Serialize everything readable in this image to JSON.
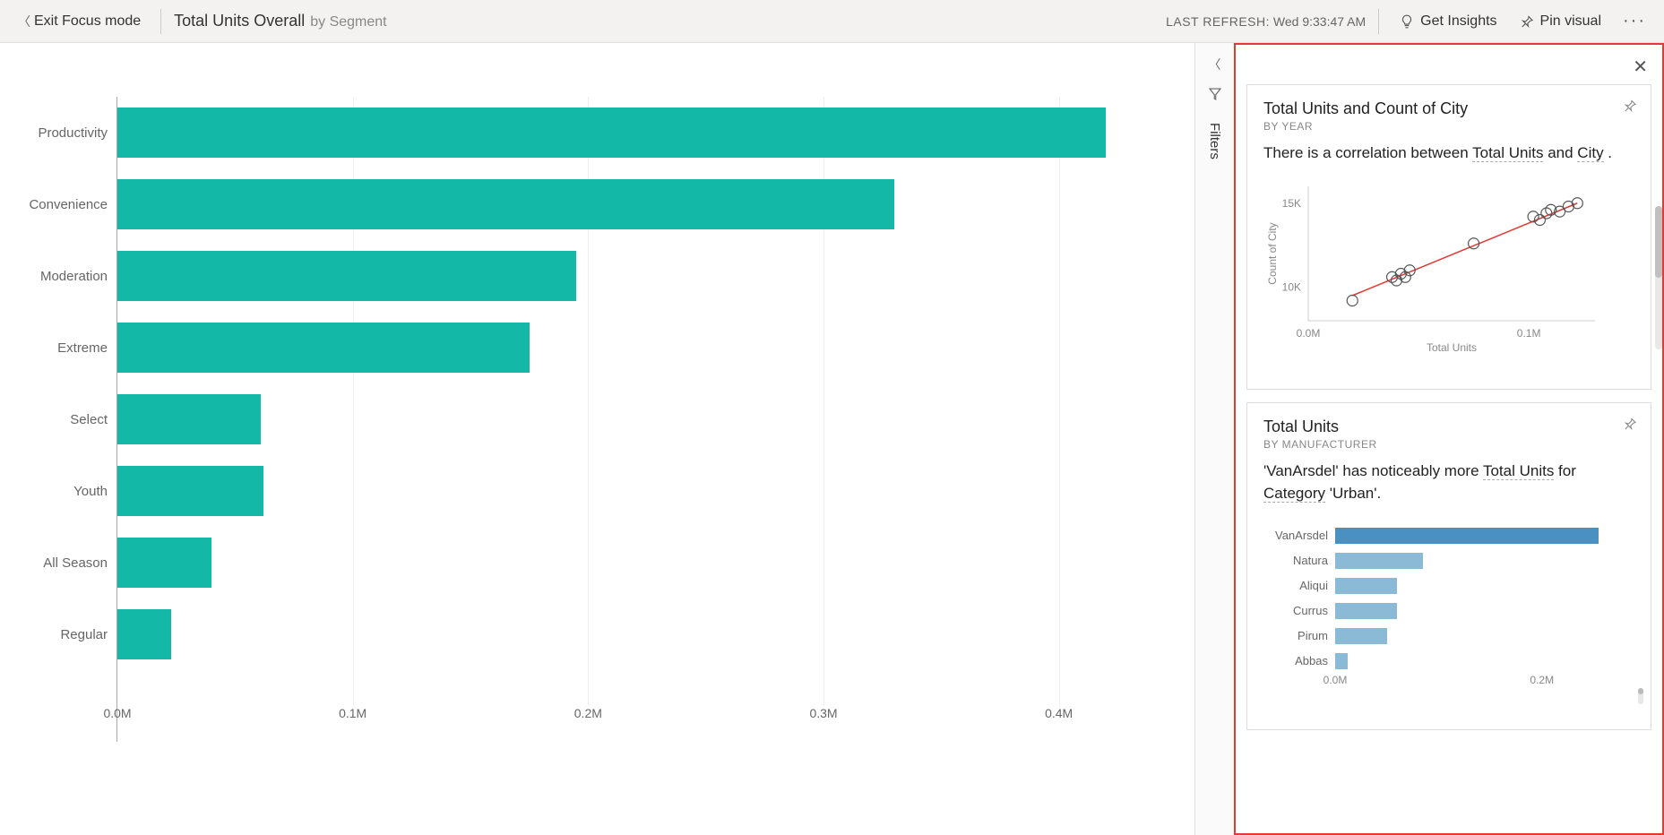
{
  "topbar": {
    "exit_label": "Exit Focus mode",
    "title": "Total Units Overall",
    "title_sub": "by Segment",
    "last_refresh_label": "LAST REFRESH:",
    "last_refresh_value": "Wed 9:33:47 AM",
    "get_insights": "Get Insights",
    "pin_visual": "Pin visual"
  },
  "filters": {
    "label": "Filters"
  },
  "chart_data": {
    "type": "bar",
    "orientation": "horizontal",
    "title": "Total Units Overall by Segment",
    "xlabel": "",
    "ylabel": "",
    "xlim": [
      0,
      0.45
    ],
    "x_ticks": [
      "0.0M",
      "0.1M",
      "0.2M",
      "0.3M",
      "0.4M"
    ],
    "categories": [
      "Productivity",
      "Convenience",
      "Moderation",
      "Extreme",
      "Select",
      "Youth",
      "All Season",
      "Regular"
    ],
    "values": [
      0.42,
      0.33,
      0.195,
      0.175,
      0.061,
      0.062,
      0.04,
      0.023
    ],
    "color": "#14b8a6"
  },
  "insights": {
    "cards": [
      {
        "title": "Total Units and Count of City",
        "subtitle": "BY YEAR",
        "desc_parts": [
          "There is a correlation between ",
          "Total Units",
          " and ",
          "City",
          " ."
        ],
        "chart": {
          "type": "scatter",
          "xlabel": "Total Units",
          "ylabel": "Count of City",
          "x_ticks": [
            "0.0M",
            "0.1M"
          ],
          "y_ticks": [
            "10K",
            "15K"
          ],
          "xlim": [
            0,
            0.13
          ],
          "ylim": [
            8,
            16
          ],
          "points": [
            {
              "x": 0.02,
              "y": 9.2
            },
            {
              "x": 0.038,
              "y": 10.6
            },
            {
              "x": 0.04,
              "y": 10.4
            },
            {
              "x": 0.042,
              "y": 10.8
            },
            {
              "x": 0.044,
              "y": 10.6
            },
            {
              "x": 0.046,
              "y": 11.0
            },
            {
              "x": 0.075,
              "y": 12.6
            },
            {
              "x": 0.102,
              "y": 14.2
            },
            {
              "x": 0.105,
              "y": 14.0
            },
            {
              "x": 0.108,
              "y": 14.4
            },
            {
              "x": 0.11,
              "y": 14.6
            },
            {
              "x": 0.114,
              "y": 14.5
            },
            {
              "x": 0.118,
              "y": 14.8
            },
            {
              "x": 0.122,
              "y": 15.0
            }
          ],
          "trend": {
            "x1": 0.02,
            "y1": 9.5,
            "x2": 0.122,
            "y2": 15.0
          },
          "trend_color": "#e53935"
        }
      },
      {
        "title": "Total Units",
        "subtitle": "BY MANUFACTURER",
        "desc_parts": [
          "'VanArsdel' has noticeably more ",
          "Total Units",
          " for ",
          "Category",
          " 'Urban'."
        ],
        "chart": {
          "type": "bar",
          "orientation": "horizontal",
          "xlabel": "",
          "x_ticks": [
            "0.0M",
            "0.2M"
          ],
          "xlim": [
            0,
            0.26
          ],
          "categories": [
            "VanArsdel",
            "Natura",
            "Aliqui",
            "Currus",
            "Pirum",
            "Abbas"
          ],
          "values": [
            0.255,
            0.085,
            0.06,
            0.06,
            0.05,
            0.012
          ],
          "colors": [
            "#4a90c2",
            "#8bbad6",
            "#8bbad6",
            "#8bbad6",
            "#8bbad6",
            "#8bbad6"
          ]
        }
      }
    ]
  }
}
